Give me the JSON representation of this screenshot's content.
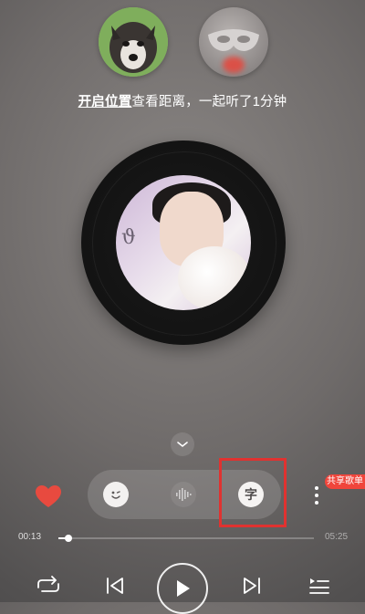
{
  "together": {
    "location_link": "开启位置",
    "message": "查看距离，一起听了1分钟"
  },
  "tools": {
    "lyrics_label": "字"
  },
  "share_badge": "共享歌单",
  "player": {
    "current_time": "00:13",
    "total_time": "05:25",
    "progress": 0.04
  },
  "colors": {
    "accent_red": "#e03230",
    "heart_red": "#e84a3f",
    "badge_red": "#f0453b"
  },
  "icons": {
    "chevron": "chevron-down-icon",
    "emoji": "emoji-icon",
    "voice": "sound-wave-icon",
    "heart": "heart-icon",
    "more": "more-vertical-icon",
    "repeat": "repeat-icon",
    "prev": "skip-previous-icon",
    "play": "play-icon",
    "next": "skip-next-icon",
    "playlist": "playlist-icon"
  }
}
